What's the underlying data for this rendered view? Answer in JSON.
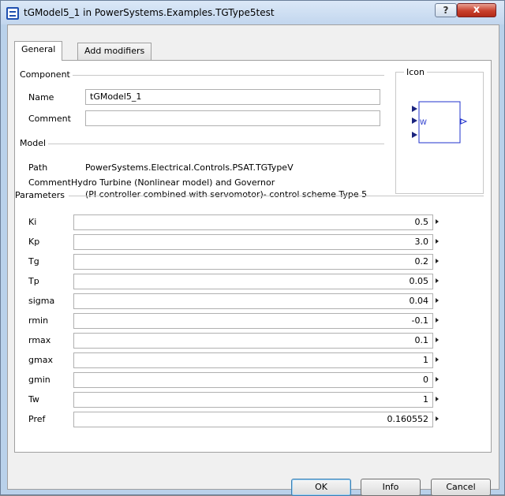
{
  "window": {
    "title": "tGModel5_1 in PowerSystems.Examples.TGType5test",
    "help_label": "?",
    "close_label": "x"
  },
  "tabs": [
    {
      "label": "General",
      "active": true
    },
    {
      "label": "Add modifiers",
      "active": false
    }
  ],
  "component": {
    "group_label": "Component",
    "name_label": "Name",
    "name_value": "tGModel5_1",
    "comment_label": "Comment",
    "comment_value": ""
  },
  "icon": {
    "group_label": "Icon",
    "inner_label": "W"
  },
  "model": {
    "group_label": "Model",
    "path_label": "Path",
    "path_value": "PowerSystems.Electrical.Controls.PSAT.TGTypeV",
    "comment_label": "Comment",
    "comment_line1": "Hydro Turbine (Nonlinear model) and Governor",
    "comment_line2": "(PI controller combined with servomotor)- control scheme Type 5"
  },
  "parameters": {
    "group_label": "Parameters",
    "items": [
      {
        "name": "Ki",
        "value": "0.5"
      },
      {
        "name": "Kp",
        "value": "3.0"
      },
      {
        "name": "Tg",
        "value": "0.2"
      },
      {
        "name": "Tp",
        "value": "0.05"
      },
      {
        "name": "sigma",
        "value": "0.04"
      },
      {
        "name": "rmin",
        "value": "-0.1"
      },
      {
        "name": "rmax",
        "value": "0.1"
      },
      {
        "name": "gmax",
        "value": "1"
      },
      {
        "name": "gmin",
        "value": "0"
      },
      {
        "name": "Tw",
        "value": "1"
      },
      {
        "name": "Pref",
        "value": "0.160552"
      }
    ]
  },
  "buttons": {
    "ok": "OK",
    "info": "Info",
    "cancel": "Cancel"
  },
  "colors": {
    "titlebar": "#c2d6ee",
    "close_button": "#c8402c",
    "icon_stroke": "#2233cc"
  }
}
